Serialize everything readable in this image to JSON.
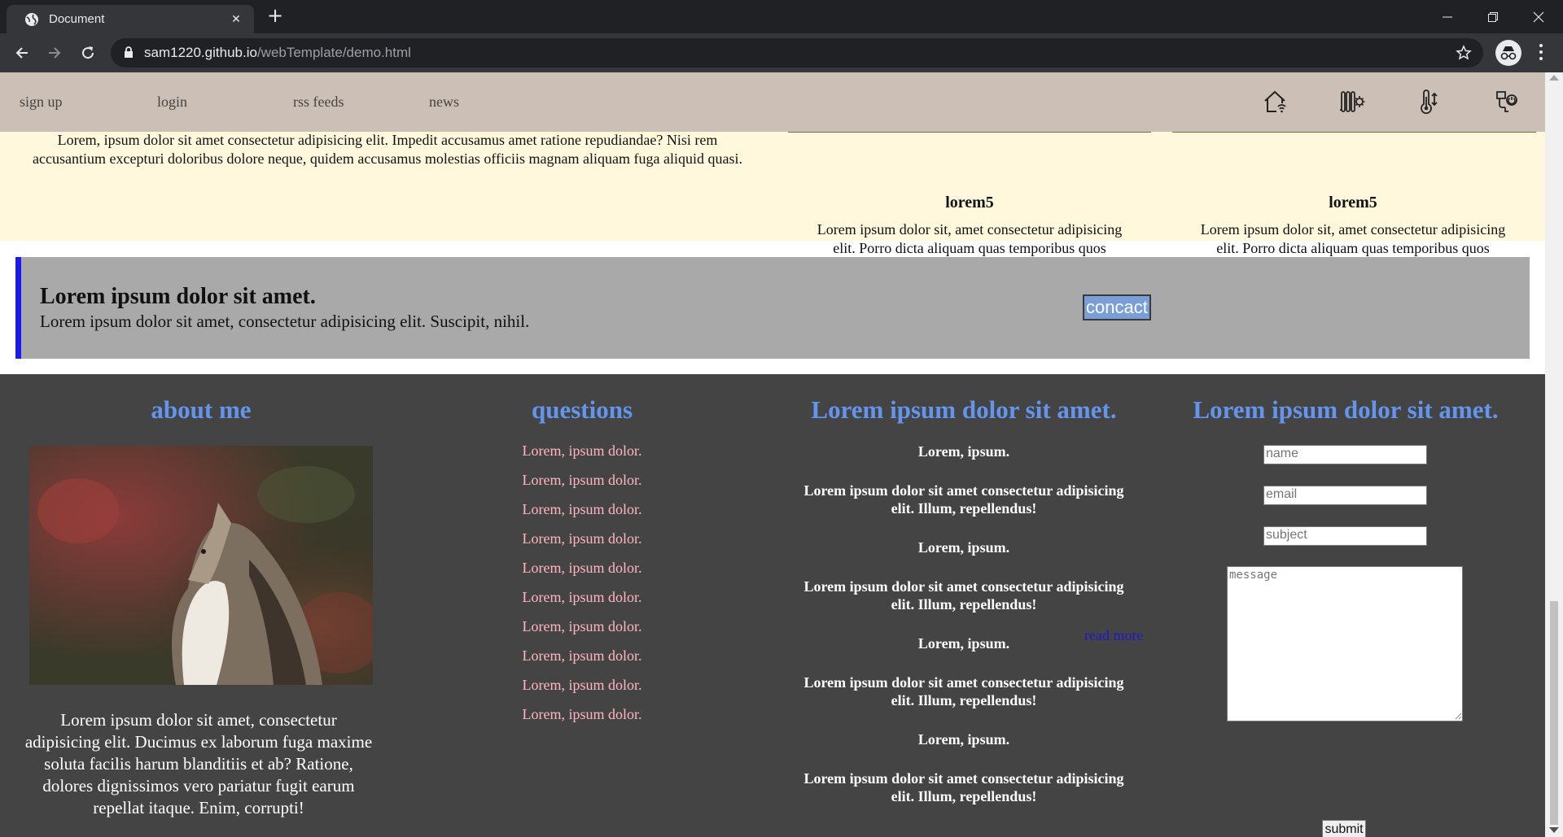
{
  "browser": {
    "tab_title": "Document",
    "url_host": "sam1220.github.io",
    "url_path": "/webTemplate/demo.html"
  },
  "nav": {
    "links": [
      "sign up",
      "login",
      "rss feeds",
      "news"
    ],
    "icons": [
      "smart-home-icon",
      "heater-icon",
      "thermometer-icon",
      "smart-tap-icon"
    ]
  },
  "intro": {
    "text": "Lorem, ipsum dolor sit amet consectetur adipisicing elit. Impedit accusamus amet ratione repudiandae? Nisi rem accusantium excepturi doloribus dolore neque, quidem accusamus molestias officiis magnam aliquam fuga aliquid quasi."
  },
  "cards": [
    {
      "title": "lorem5",
      "text": "Lorem ipsum dolor sit, amet consectetur adipisicing elit. Porro dicta aliquam quas temporibus quos assumenda, aliquid enim. Maiores, atque mollitia."
    },
    {
      "title": "lorem5",
      "text": "Lorem ipsum dolor sit, amet consectetur adipisicing elit. Porro dicta aliquam quas temporibus quos assumenda, aliquid enim. Maiores, atque mollitia."
    }
  ],
  "banner": {
    "heading": "Lorem ipsum dolor sit amet.",
    "text": "Lorem ipsum dolor sit amet, consectetur adipisicing elit. Suscipit, nihil.",
    "button": "concact"
  },
  "footer": {
    "about": {
      "title": "about me",
      "text": "Lorem ipsum dolor sit amet, consectetur adipisicing elit. Ducimus ex laborum fuga maxime soluta facilis harum blanditiis et ab? Ratione, dolores dignissimos vero pariatur fugit earum repellat itaque. Enim, corrupti!"
    },
    "questions": {
      "title": "questions",
      "items": [
        "Lorem, ipsum dolor.",
        "Lorem, ipsum dolor.",
        "Lorem, ipsum dolor.",
        "Lorem, ipsum dolor.",
        "Lorem, ipsum dolor.",
        "Lorem, ipsum dolor.",
        "Lorem, ipsum dolor.",
        "Lorem, ipsum dolor.",
        "Lorem, ipsum dolor.",
        "Lorem, ipsum dolor."
      ]
    },
    "faq": {
      "title": "Lorem ipsum dolor sit amet.",
      "q": "Lorem, ipsum.",
      "a": "Lorem ipsum dolor sit amet consectetur adipisicing elit. Illum, repellendus!",
      "read_more": "read more"
    },
    "form": {
      "title": "Lorem ipsum dolor sit amet.",
      "name_placeholder": "name",
      "email_placeholder": "email",
      "subject_placeholder": "subject",
      "message_placeholder": "message",
      "submit": "submit"
    }
  }
}
